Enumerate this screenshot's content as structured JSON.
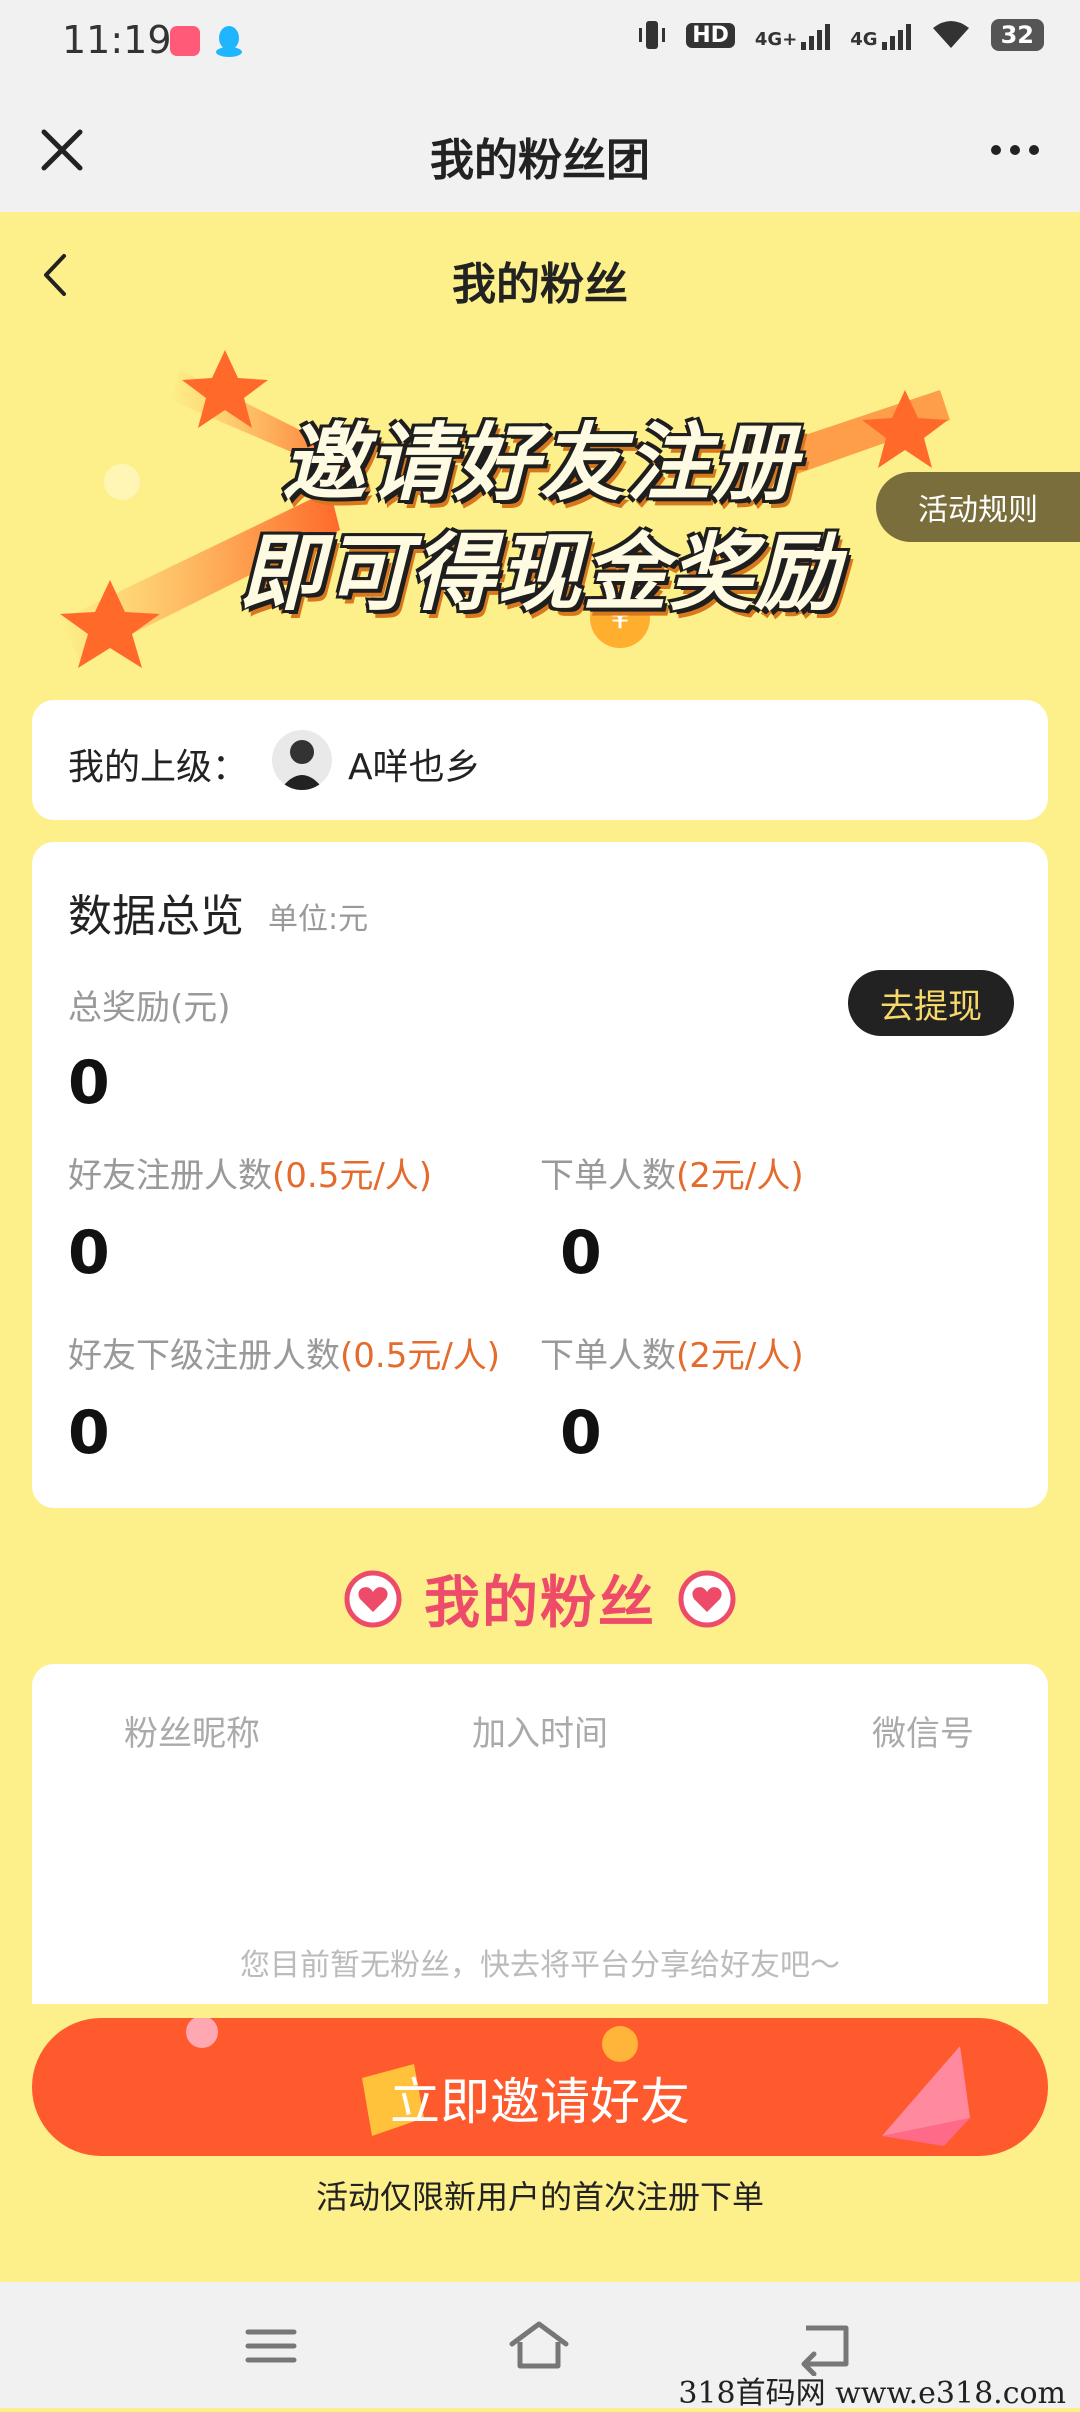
{
  "status_bar": {
    "time": "11:19",
    "hd_label": "HD",
    "net1": "4G+",
    "net2": "4G",
    "battery": "32"
  },
  "title_bar": {
    "title": "我的粉丝团"
  },
  "header": {
    "sub_title": "我的粉丝"
  },
  "banner": {
    "line1": "邀请好友注册",
    "line2": "即可得现金奖励",
    "rules_button": "活动规则"
  },
  "superior": {
    "label": "我的上级：",
    "name": "A咩也乡"
  },
  "overview": {
    "title": "数据总览",
    "unit": "单位:元",
    "total_label": "总奖励(元)",
    "total_value": "0",
    "withdraw_button": "去提现",
    "stats": [
      {
        "label": "好友注册人数",
        "rate": "(0.5元/人)",
        "value": "0"
      },
      {
        "label": "下单人数",
        "rate": "(2元/人)",
        "value": "0"
      },
      {
        "label": "好友下级注册人数",
        "rate": "(0.5元/人)",
        "value": "0"
      },
      {
        "label": "下单人数",
        "rate": "(2元/人)",
        "value": "0"
      }
    ]
  },
  "fans": {
    "heading": "我的粉丝",
    "columns": [
      "粉丝昵称",
      "加入时间",
      "微信号"
    ],
    "empty_text": "您目前暂无粉丝，快去将平台分享给好友吧～"
  },
  "invite": {
    "button": "立即邀请好友",
    "notice": "活动仅限新用户的首次注册下单"
  },
  "watermark": "318首码网  www.e318.com",
  "colors": {
    "background": "#fdf08a",
    "accent_orange": "#ff5a2e",
    "heading_pink": "#ee4a6a",
    "rate_orange": "#e46b2c"
  }
}
